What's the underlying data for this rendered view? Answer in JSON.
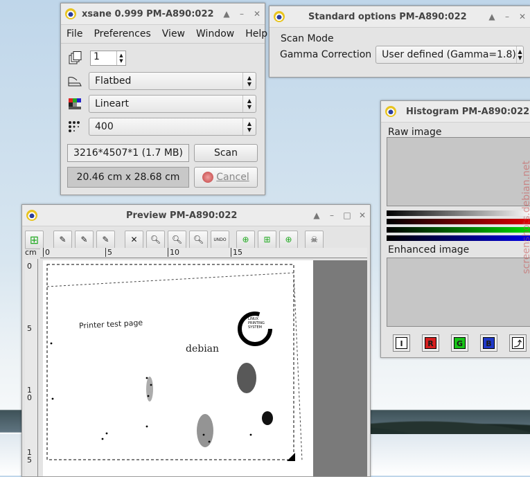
{
  "xsane": {
    "title": "xsane 0.999 PM-A890:022",
    "menu": [
      "File",
      "Preferences",
      "View",
      "Window",
      "Help"
    ],
    "copies": "1",
    "source": "Flatbed",
    "mode": "Lineart",
    "resolution": "400",
    "image_size": "3216*4507*1 (1.7 MB)",
    "scan_label": "Scan",
    "dimensions": "20.46 cm x 28.68 cm",
    "cancel_label": "Cancel"
  },
  "standard_options": {
    "title": "Standard options PM-A890:022",
    "group": "Scan Mode",
    "gamma_label": "Gamma Correction",
    "gamma_value": "User defined (Gamma=1.8)"
  },
  "histogram": {
    "title": "Histogram PM-A890:022",
    "raw_label": "Raw image",
    "enhanced_label": "Enhanced image",
    "buttons": [
      "I",
      "R",
      "G",
      "B"
    ],
    "colors": {
      "red": "#d62020",
      "green": "#18c418",
      "blue": "#1f38c8"
    }
  },
  "preview": {
    "title": "Preview PM-A890:022",
    "ruler_unit": "cm",
    "h_ticks": [
      "0",
      "5",
      "10",
      "15"
    ],
    "v_ticks": [
      "0",
      "5",
      "1\n0",
      "1\n5"
    ],
    "page_text": [
      "Printer test page",
      "debian"
    ],
    "logo_text": "LINUX PRINTING SYSTEM",
    "undo_label": "UNDO"
  },
  "watermark": "screenshots.debian.net"
}
